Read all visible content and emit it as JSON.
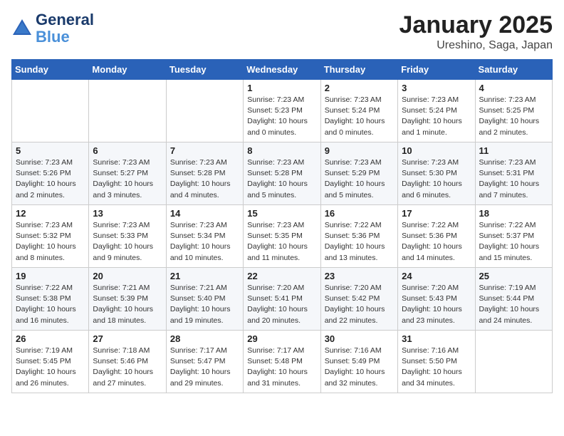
{
  "header": {
    "logo_line1": "General",
    "logo_line2": "Blue",
    "month": "January 2025",
    "location": "Ureshino, Saga, Japan"
  },
  "weekdays": [
    "Sunday",
    "Monday",
    "Tuesday",
    "Wednesday",
    "Thursday",
    "Friday",
    "Saturday"
  ],
  "weeks": [
    [
      {
        "day": "",
        "empty": true
      },
      {
        "day": "",
        "empty": true
      },
      {
        "day": "",
        "empty": true
      },
      {
        "day": "1",
        "sunrise": "7:23 AM",
        "sunset": "5:23 PM",
        "daylight": "10 hours and 0 minutes."
      },
      {
        "day": "2",
        "sunrise": "7:23 AM",
        "sunset": "5:24 PM",
        "daylight": "10 hours and 0 minutes."
      },
      {
        "day": "3",
        "sunrise": "7:23 AM",
        "sunset": "5:24 PM",
        "daylight": "10 hours and 1 minute."
      },
      {
        "day": "4",
        "sunrise": "7:23 AM",
        "sunset": "5:25 PM",
        "daylight": "10 hours and 2 minutes."
      }
    ],
    [
      {
        "day": "5",
        "sunrise": "7:23 AM",
        "sunset": "5:26 PM",
        "daylight": "10 hours and 2 minutes."
      },
      {
        "day": "6",
        "sunrise": "7:23 AM",
        "sunset": "5:27 PM",
        "daylight": "10 hours and 3 minutes."
      },
      {
        "day": "7",
        "sunrise": "7:23 AM",
        "sunset": "5:28 PM",
        "daylight": "10 hours and 4 minutes."
      },
      {
        "day": "8",
        "sunrise": "7:23 AM",
        "sunset": "5:28 PM",
        "daylight": "10 hours and 5 minutes."
      },
      {
        "day": "9",
        "sunrise": "7:23 AM",
        "sunset": "5:29 PM",
        "daylight": "10 hours and 5 minutes."
      },
      {
        "day": "10",
        "sunrise": "7:23 AM",
        "sunset": "5:30 PM",
        "daylight": "10 hours and 6 minutes."
      },
      {
        "day": "11",
        "sunrise": "7:23 AM",
        "sunset": "5:31 PM",
        "daylight": "10 hours and 7 minutes."
      }
    ],
    [
      {
        "day": "12",
        "sunrise": "7:23 AM",
        "sunset": "5:32 PM",
        "daylight": "10 hours and 8 minutes."
      },
      {
        "day": "13",
        "sunrise": "7:23 AM",
        "sunset": "5:33 PM",
        "daylight": "10 hours and 9 minutes."
      },
      {
        "day": "14",
        "sunrise": "7:23 AM",
        "sunset": "5:34 PM",
        "daylight": "10 hours and 10 minutes."
      },
      {
        "day": "15",
        "sunrise": "7:23 AM",
        "sunset": "5:35 PM",
        "daylight": "10 hours and 11 minutes."
      },
      {
        "day": "16",
        "sunrise": "7:22 AM",
        "sunset": "5:36 PM",
        "daylight": "10 hours and 13 minutes."
      },
      {
        "day": "17",
        "sunrise": "7:22 AM",
        "sunset": "5:36 PM",
        "daylight": "10 hours and 14 minutes."
      },
      {
        "day": "18",
        "sunrise": "7:22 AM",
        "sunset": "5:37 PM",
        "daylight": "10 hours and 15 minutes."
      }
    ],
    [
      {
        "day": "19",
        "sunrise": "7:22 AM",
        "sunset": "5:38 PM",
        "daylight": "10 hours and 16 minutes."
      },
      {
        "day": "20",
        "sunrise": "7:21 AM",
        "sunset": "5:39 PM",
        "daylight": "10 hours and 18 minutes."
      },
      {
        "day": "21",
        "sunrise": "7:21 AM",
        "sunset": "5:40 PM",
        "daylight": "10 hours and 19 minutes."
      },
      {
        "day": "22",
        "sunrise": "7:20 AM",
        "sunset": "5:41 PM",
        "daylight": "10 hours and 20 minutes."
      },
      {
        "day": "23",
        "sunrise": "7:20 AM",
        "sunset": "5:42 PM",
        "daylight": "10 hours and 22 minutes."
      },
      {
        "day": "24",
        "sunrise": "7:20 AM",
        "sunset": "5:43 PM",
        "daylight": "10 hours and 23 minutes."
      },
      {
        "day": "25",
        "sunrise": "7:19 AM",
        "sunset": "5:44 PM",
        "daylight": "10 hours and 24 minutes."
      }
    ],
    [
      {
        "day": "26",
        "sunrise": "7:19 AM",
        "sunset": "5:45 PM",
        "daylight": "10 hours and 26 minutes."
      },
      {
        "day": "27",
        "sunrise": "7:18 AM",
        "sunset": "5:46 PM",
        "daylight": "10 hours and 27 minutes."
      },
      {
        "day": "28",
        "sunrise": "7:17 AM",
        "sunset": "5:47 PM",
        "daylight": "10 hours and 29 minutes."
      },
      {
        "day": "29",
        "sunrise": "7:17 AM",
        "sunset": "5:48 PM",
        "daylight": "10 hours and 31 minutes."
      },
      {
        "day": "30",
        "sunrise": "7:16 AM",
        "sunset": "5:49 PM",
        "daylight": "10 hours and 32 minutes."
      },
      {
        "day": "31",
        "sunrise": "7:16 AM",
        "sunset": "5:50 PM",
        "daylight": "10 hours and 34 minutes."
      },
      {
        "day": "",
        "empty": true
      }
    ]
  ]
}
